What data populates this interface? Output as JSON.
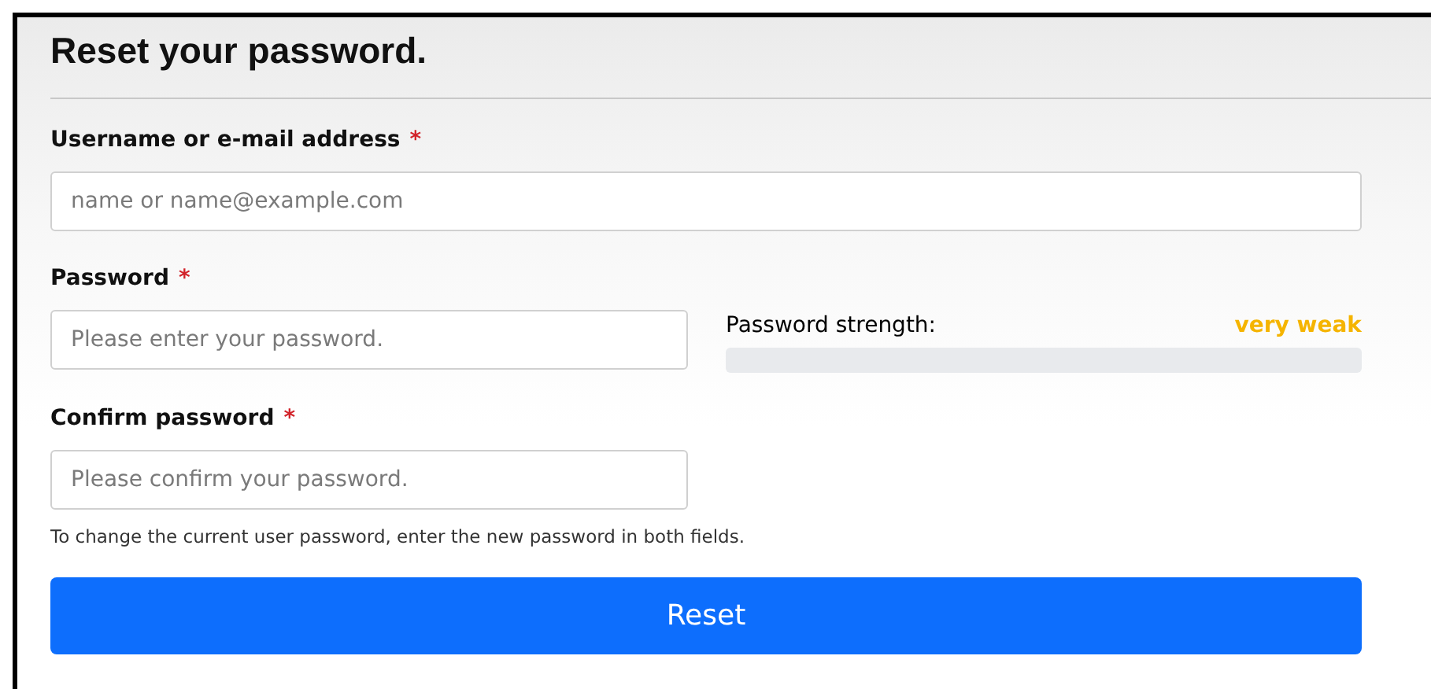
{
  "title": "Reset your password.",
  "username": {
    "label": "Username or e-mail address",
    "required_mark": "*",
    "placeholder": "name or name@example.com"
  },
  "password": {
    "label": "Password",
    "required_mark": "*",
    "placeholder": "Please enter your password."
  },
  "strength": {
    "label": "Password strength:",
    "rating": "very weak",
    "level": 0
  },
  "confirm": {
    "label": "Confirm password",
    "required_mark": "*",
    "placeholder": "Please confirm your password."
  },
  "help": "To change the current user password, enter the new password in both fields.",
  "button": "Reset"
}
